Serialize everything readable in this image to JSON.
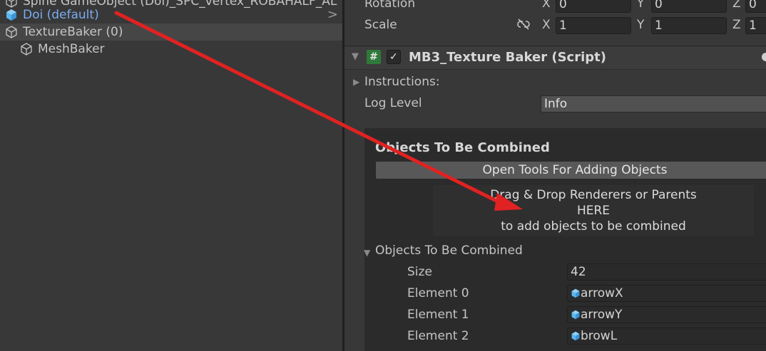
{
  "hierarchy": {
    "items": [
      {
        "label": "Spine GameObject (Doi)_SPC_vertex_ROBAHALF_AL",
        "style": "normal"
      },
      {
        "label": "Doi (default)",
        "style": "blue"
      },
      {
        "label": "TextureBaker (0)",
        "style": "selected"
      },
      {
        "label": "MeshBaker",
        "style": "child"
      }
    ]
  },
  "inspector": {
    "transform": {
      "rotation_label": "Rotation",
      "rotation": {
        "x": "0",
        "y": "0",
        "z": "0"
      },
      "scale_label": "Scale",
      "scale": {
        "x": "1",
        "y": "1",
        "z": "1"
      },
      "axis": {
        "x": "X",
        "y": "Y",
        "z": "Z"
      }
    },
    "component": {
      "title": "MB3_Texture Baker (Script)",
      "enabled": true,
      "instructions_label": "Instructions:",
      "log_level_label": "Log Level",
      "log_level_value": "Info"
    },
    "objects_box": {
      "heading": "Objects To Be Combined",
      "open_tools_button": "Open Tools For Adding Objects",
      "drop_line1": "Drag & Drop Renderers or Parents",
      "drop_line2": "HERE",
      "drop_line3": "to add objects to be combined",
      "list_label": "Objects To Be Combined",
      "size_label": "Size",
      "size_value": "42",
      "elements": [
        {
          "label": "Element 0",
          "value": "arrowX"
        },
        {
          "label": "Element 1",
          "value": "arrowY"
        },
        {
          "label": "Element 2",
          "value": "browL"
        }
      ]
    }
  },
  "colors": {
    "annotation_arrow": "#e02222",
    "link_blue": "#7bacf0",
    "cube_blue": "#5cb6f0"
  }
}
